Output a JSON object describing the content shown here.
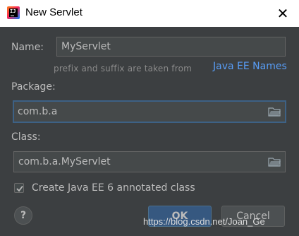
{
  "window": {
    "title": "New Servlet",
    "app_icon_text": "IJ",
    "close_glyph": "✕"
  },
  "form": {
    "name_label": "Name:",
    "name_value": "MyServlet",
    "hint_text": "prefix and suffix are taken from",
    "hint_link": "Java EE Names",
    "package_label": "Package:",
    "package_value": "com.b.a",
    "class_label": "Class:",
    "class_value": "com.b.a.MyServlet",
    "checkbox_checked": true,
    "checkbox_label": "Create Java EE 6 annotated class"
  },
  "footer": {
    "help_glyph": "?",
    "ok_label": "OK",
    "cancel_label": "Cancel"
  },
  "watermark": "https://blog.csdn.net/Joan_Ge",
  "icons": [
    "app-icon",
    "close-icon",
    "folder-icon",
    "checkmark-icon",
    "help-icon"
  ],
  "colors": {
    "dialog_bg": "#3c3f41",
    "field_bg": "#45494a",
    "focus_border": "#3d6185",
    "link": "#589df6",
    "ok_button": "#365880"
  }
}
